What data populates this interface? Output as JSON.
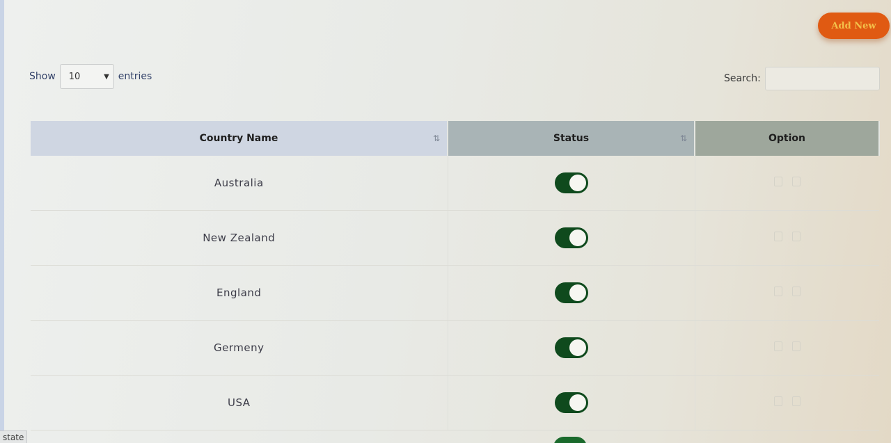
{
  "toolbar": {
    "add_new_label": "Add New"
  },
  "length": {
    "show_label": "Show",
    "selected": "10",
    "entries_label": "entries"
  },
  "search": {
    "label": "Search:",
    "value": ""
  },
  "table": {
    "headers": {
      "country": "Country Name",
      "status": "Status",
      "option": "Option"
    },
    "rows": [
      {
        "country": "Australia",
        "status_on": true
      },
      {
        "country": "New Zealand",
        "status_on": true
      },
      {
        "country": "England",
        "status_on": true
      },
      {
        "country": "Germeny",
        "status_on": true
      },
      {
        "country": "USA",
        "status_on": true
      }
    ]
  },
  "icons": {
    "sort": "sort-arrows-icon",
    "select_chevron": "chevron-down-icon",
    "row_options": [
      "edit-icon",
      "delete-icon"
    ]
  },
  "colors": {
    "accent_button": "#e05a12",
    "toggle_on": "#0f4a1d"
  },
  "status_bar": {
    "text": "state"
  }
}
